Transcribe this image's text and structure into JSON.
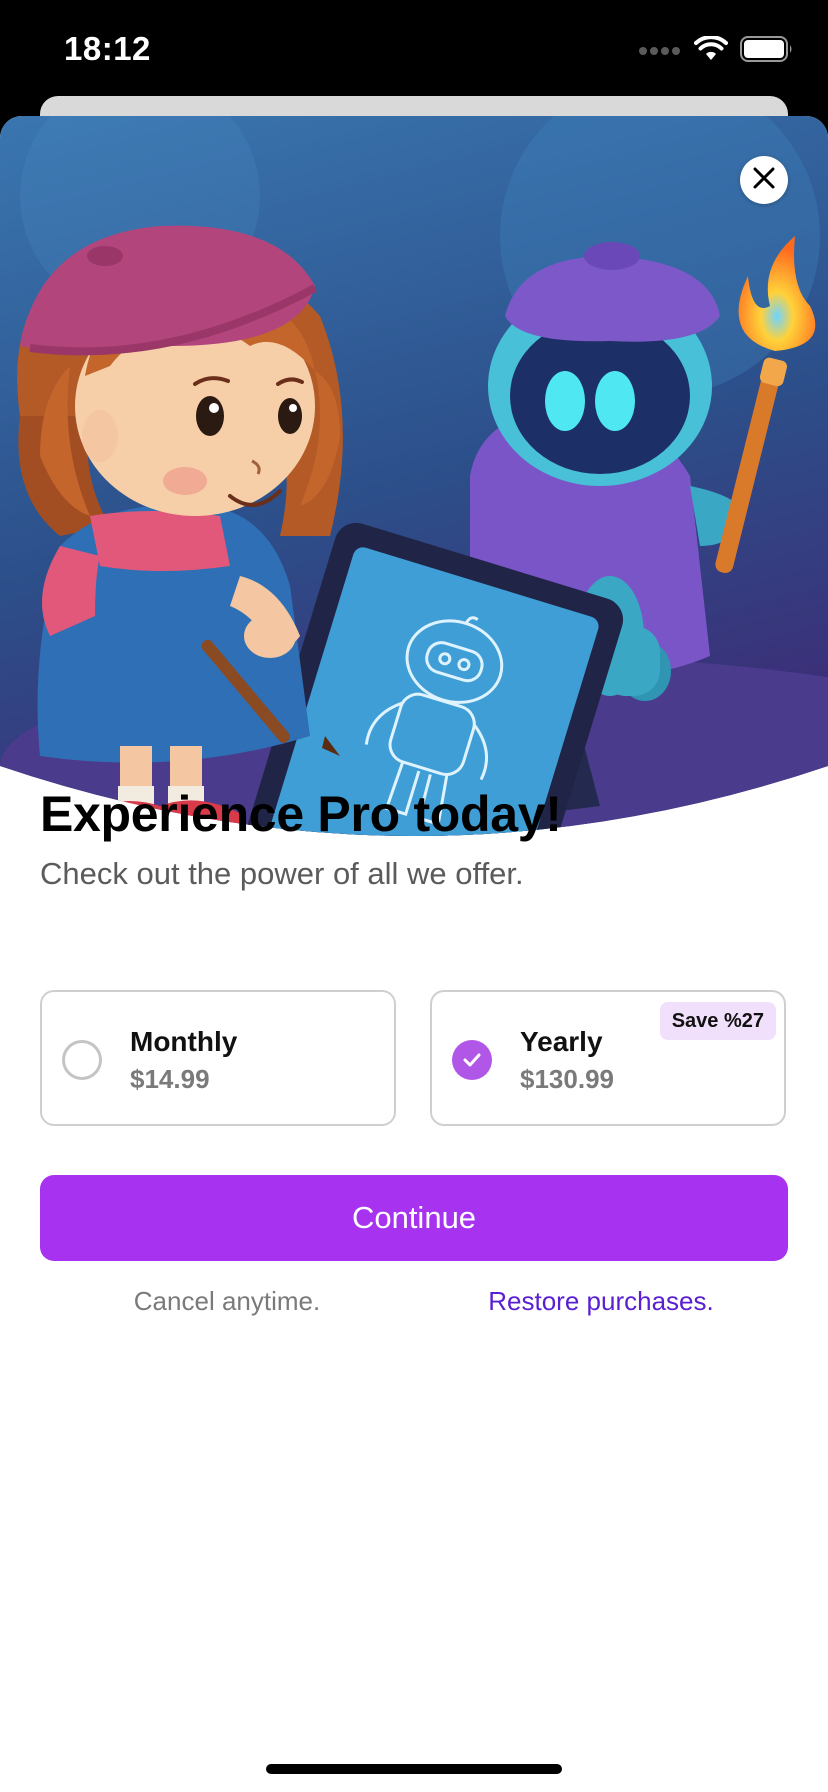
{
  "status_bar": {
    "time": "18:12"
  },
  "paywall": {
    "title": "Experience Pro today!",
    "subtitle": "Check out the power of all we offer.",
    "plans": [
      {
        "name": "Monthly",
        "price": "$14.99",
        "selected": false
      },
      {
        "name": "Yearly",
        "price": "$130.99",
        "selected": true,
        "badge": "Save %27"
      }
    ],
    "continue_label": "Continue",
    "cancel_note": "Cancel anytime.",
    "restore_label": "Restore purchases."
  },
  "colors": {
    "accent": "#a733f0",
    "selected_radio": "#b057e8",
    "badge_bg": "#f1e0fb",
    "link": "#5a1fd1"
  },
  "icons": {
    "close": "close-icon",
    "check": "check-icon",
    "wifi": "wifi-icon",
    "battery": "battery-icon",
    "signal": "signal-dots-icon"
  }
}
